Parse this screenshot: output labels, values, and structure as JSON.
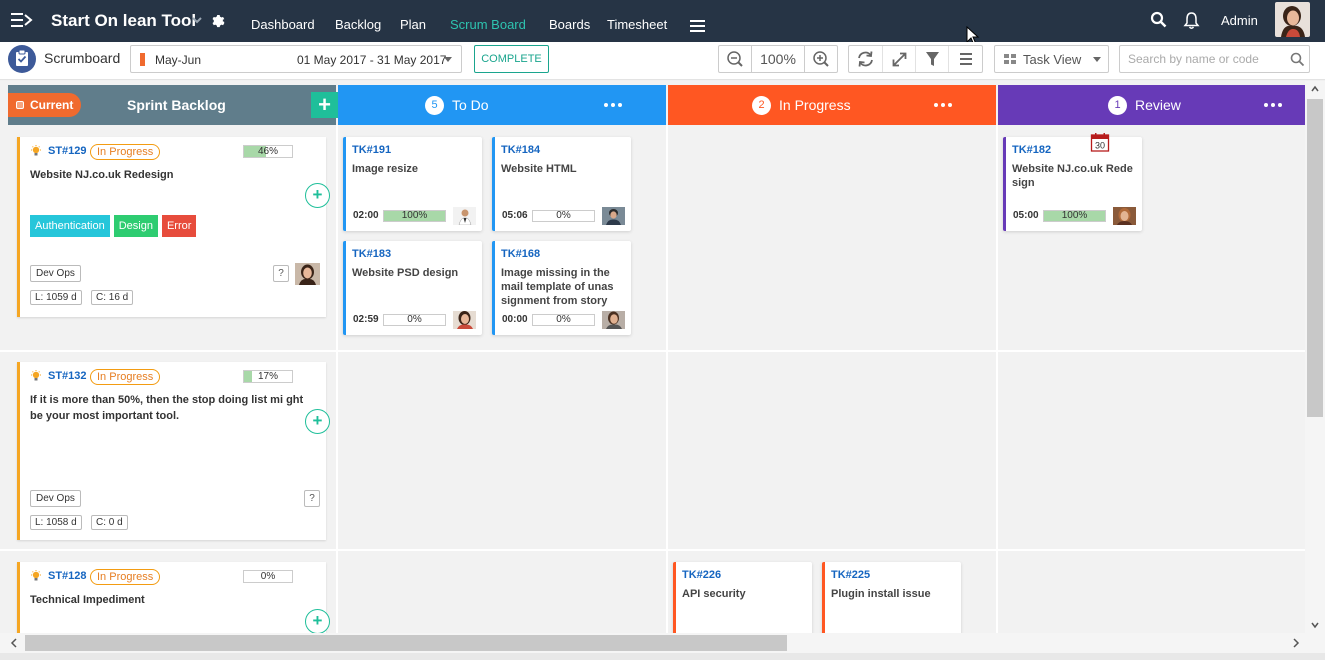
{
  "app": {
    "title": "Start On lean Tool",
    "nav": [
      "Dashboard",
      "Backlog",
      "Plan",
      "Scrum Board",
      "Boards",
      "Timesheet"
    ],
    "active_nav": "Scrum Board",
    "user_name": "Admin"
  },
  "toolbar": {
    "page_title": "Scrumboard",
    "sprint_name": "May-Jun",
    "sprint_range": "01 May 2017 - 31 May 2017",
    "complete_label": "COMPLETE",
    "zoom": "100%",
    "view_label": "Task View",
    "search_placeholder": "Search by name or code"
  },
  "colors": {
    "topnav": "#263445",
    "active_nav": "#2ec4b0",
    "backlog_header": "#607d8b",
    "current": "#f06a2e",
    "todo": "#2196f3",
    "in_progress": "#ff5722",
    "review": "#673ab7",
    "add_green": "#1fbf9a",
    "story_border": "#f5a623"
  },
  "columns": {
    "backlog": {
      "current_label": "Current",
      "title": "Sprint Backlog"
    },
    "todo": {
      "count": "5",
      "label": "To Do"
    },
    "in_progress": {
      "count": "2",
      "label": "In Progress"
    },
    "review": {
      "count": "1",
      "label": "Review"
    }
  },
  "stories": [
    {
      "id": "ST#129",
      "status": "In Progress",
      "progress": "46%",
      "progress_value": 46,
      "title": "Website NJ.co.uk Redesign",
      "tags": [
        {
          "label": "Authentication",
          "color": "#26c6da"
        },
        {
          "label": "Design",
          "color": "#2ecc71"
        },
        {
          "label": "Error",
          "color": "#e74c3c"
        }
      ],
      "team": "Dev Ops",
      "qmark": "?",
      "lead_time": "L: 1059 d",
      "cycle_time": "C: 16 d"
    },
    {
      "id": "ST#132",
      "status": "In Progress",
      "progress": "17%",
      "progress_value": 17,
      "title": "If it is more than 50%, then the stop doing list mi ght be your most important tool.",
      "team": "Dev Ops",
      "qmark": "?",
      "lead_time": "L: 1058 d",
      "cycle_time": "C: 0 d"
    },
    {
      "id": "ST#128",
      "status": "In Progress",
      "progress": "0%",
      "progress_value": 0,
      "title": "Technical Impediment"
    }
  ],
  "tasks": {
    "todo": [
      {
        "id": "TK#191",
        "title": "Image resize",
        "time": "02:00",
        "progress": "100%",
        "progress_value": 100
      },
      {
        "id": "TK#184",
        "title": "Website HTML",
        "time": "05:06",
        "progress": "0%",
        "progress_value": 0
      },
      {
        "id": "TK#183",
        "title": "Website PSD design",
        "time": "02:59",
        "progress": "0%",
        "progress_value": 0
      },
      {
        "id": "TK#168",
        "title": "Image missing in the mail template of unas signment from story",
        "time": "00:00",
        "progress": "0%",
        "progress_value": 0
      }
    ],
    "review": [
      {
        "id": "TK#182",
        "title": "Website NJ.co.uk Rede sign",
        "time": "05:00",
        "progress": "100%",
        "progress_value": 100,
        "calendar_day": "30"
      }
    ],
    "in_progress": [
      {
        "id": "TK#226",
        "title": "API security"
      },
      {
        "id": "TK#225",
        "title": "Plugin install issue"
      }
    ]
  }
}
